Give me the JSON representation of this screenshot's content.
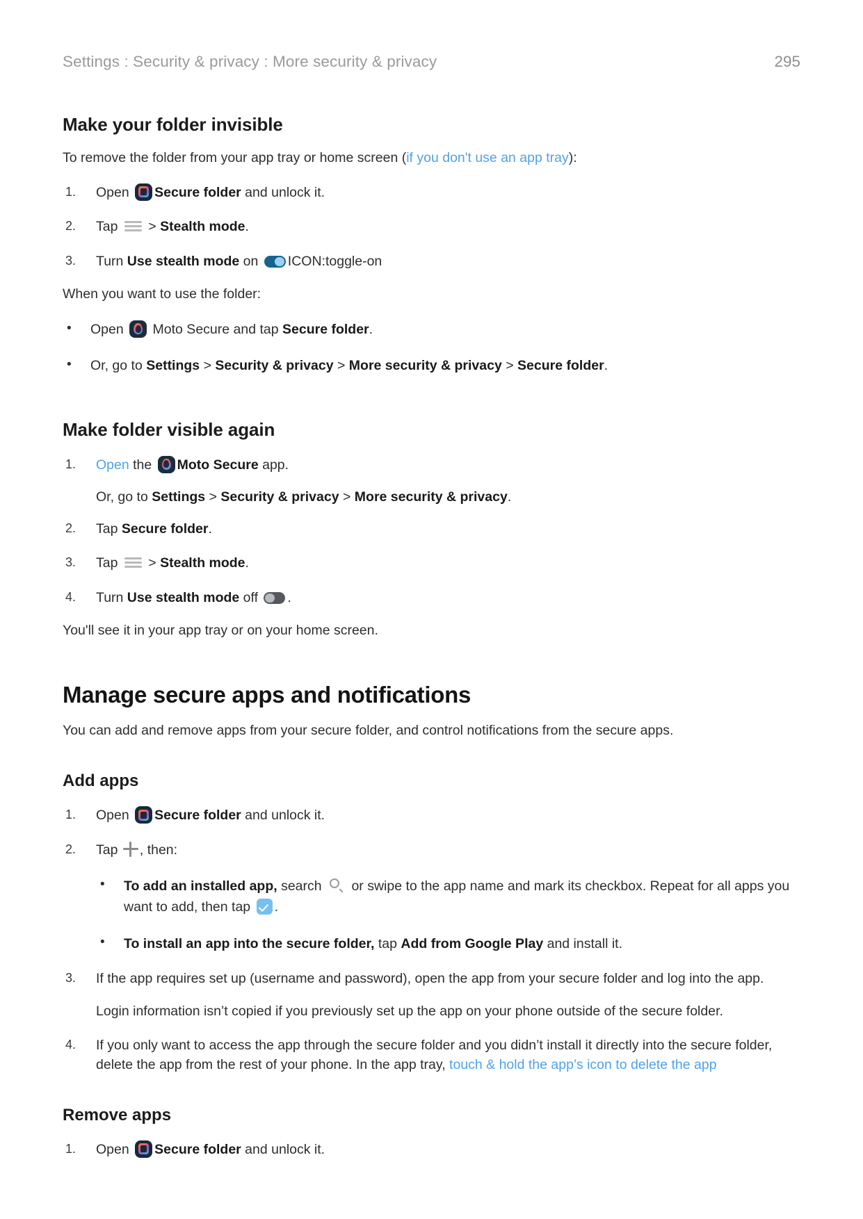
{
  "header": {
    "breadcrumb": "Settings : Security & privacy : More security & privacy",
    "page_number": "295"
  },
  "colors": {
    "link": "#4ea3e8",
    "toggle_on": "#14658c",
    "toggle_on_knob": "#9fd0ef",
    "toggle_off": "#55595d",
    "toggle_off_knob": "#b8bcc0",
    "checkbox": "#74c0f0",
    "heading": "#1c1c1c",
    "body_text": "#2e2e2e",
    "header_gray": "#9a9a9a"
  },
  "sections": {
    "make_invisible": {
      "heading": "Make your folder invisible",
      "intro_before": "To remove the folder from your app tray or home screen (",
      "intro_link": "if you don't use an app tray",
      "intro_after": "):",
      "steps": [
        {
          "num": "1.",
          "parts": [
            "Open ",
            "ICON:secure-folder",
            "Secure folder",
            " and unlock it."
          ]
        },
        {
          "num": "2.",
          "parts": [
            "Tap ",
            "ICON:menu",
            " > ",
            "Stealth mode",
            "."
          ]
        },
        {
          "num": "3.",
          "parts": [
            "Turn ",
            "Use stealth mode",
            " on ",
            "ICON:toggle-on",
            "."
          ]
        }
      ],
      "when_use": "When you want to use the folder:",
      "bullets": [
        {
          "text_1": "Open ",
          "icon": "moto-secure-icon",
          "text_2": " Moto Secure and tap ",
          "bold": "Secure folder",
          "text_3": "."
        },
        {
          "text_1": "Or, go to ",
          "crumbs": [
            "Settings",
            "Security & privacy",
            "More security & privacy",
            "Secure folder"
          ],
          "text_3": "."
        }
      ]
    },
    "make_visible": {
      "heading": "Make folder visible again",
      "steps": [
        {
          "num": "1.",
          "link": "Open",
          "text_1": " the ",
          "icon": "moto-secure-icon",
          "bold": "Moto Secure",
          "text_2": " app."
        },
        {
          "num": "2.",
          "text_1": "Tap ",
          "bold": "Secure folder",
          "text_2": "."
        },
        {
          "num": "3.",
          "text_1": "Tap ",
          "icon": "menu-icon",
          "text_2": " > ",
          "bold": "Stealth mode",
          "text_3": "."
        },
        {
          "num": "4.",
          "text_1": "Turn ",
          "bold": "Use stealth mode",
          "text_2": " off ",
          "icon": "toggle-off-icon",
          "text_3": "."
        }
      ],
      "sub_note": {
        "text_1": "Or, go to ",
        "crumbs": [
          "Settings",
          "Security & privacy",
          "More security & privacy"
        ],
        "text_2": "."
      },
      "closing": "You'll see it in your app tray or on your home screen."
    },
    "manage": {
      "heading": "Manage secure apps and notifications",
      "intro": "You can add and remove apps from your secure folder, and control notifications from the secure apps.",
      "add_apps": {
        "heading": "Add apps",
        "step1": {
          "num": "1.",
          "text_1": "Open ",
          "icon": "secure-folder-icon",
          "bold": "Secure folder",
          "text_2": " and unlock it."
        },
        "step2": {
          "num": "2.",
          "text_1": "Tap ",
          "icon": "plus-icon",
          "text_2": ", then:"
        },
        "sub_bullets": [
          {
            "bold": "To add an installed app,",
            "text_1": " search ",
            "icon_1": "search-icon",
            "text_2": " or swipe to the app name and mark its checkbox. Repeat for all apps you want to add, then tap ",
            "icon_2": "checkbox-confirm-icon",
            "text_3": "."
          },
          {
            "bold": "To install an app into the secure folder,",
            "text_1": " tap ",
            "bold_2": "Add from Google Play",
            "text_2": " and install it."
          }
        ],
        "step3": {
          "num": "3.",
          "text": "If the app requires set up (username and password), open the app from your secure folder and log into the app.",
          "note": "Login information isn’t copied if you previously set up the app on your phone outside of the secure folder."
        },
        "step4": {
          "num": "4.",
          "text_1": "If you only want to access the app through the secure folder and you didn’t install it directly into the secure folder, delete the app from the rest of your phone. In the app tray, ",
          "link": "touch & hold the app’s icon to delete the app"
        }
      },
      "remove_apps": {
        "heading": "Remove apps",
        "step1": {
          "num": "1.",
          "text_1": "Open ",
          "icon": "secure-folder-icon",
          "bold": "Secure folder",
          "text_2": " and unlock it."
        }
      }
    }
  }
}
